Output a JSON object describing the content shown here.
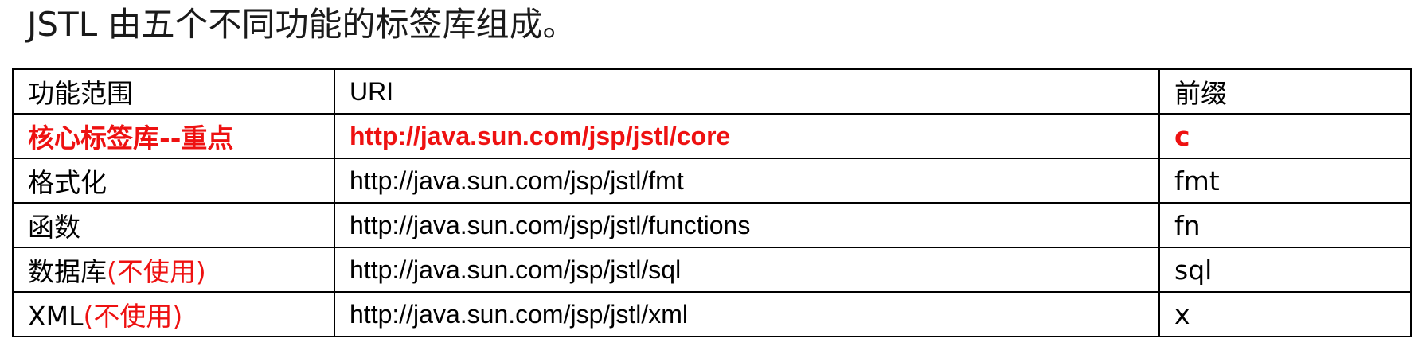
{
  "heading": "JSTL 由五个不同功能的标签库组成。",
  "table": {
    "headers": [
      "功能范围",
      "URI",
      "前缀"
    ],
    "rows": [
      {
        "scope": "核心标签库--重点",
        "note": "",
        "uri": "http://java.sun.com/jsp/jstl/core",
        "prefix": "c",
        "highlight": true
      },
      {
        "scope": "格式化",
        "note": "",
        "uri": "http://java.sun.com/jsp/jstl/fmt",
        "prefix": "fmt",
        "highlight": false
      },
      {
        "scope": "函数",
        "note": "",
        "uri": "http://java.sun.com/jsp/jstl/functions",
        "prefix": "fn",
        "highlight": false
      },
      {
        "scope": "数据库",
        "note": "(不使用)",
        "uri": "http://java.sun.com/jsp/jstl/sql",
        "prefix": "sql",
        "highlight": false
      },
      {
        "scope": "XML",
        "note": "(不使用)",
        "uri": "http://java.sun.com/jsp/jstl/xml",
        "prefix": "x",
        "highlight": false
      }
    ]
  },
  "colors": {
    "highlight": "#ee1111",
    "text": "#000000",
    "border": "#000000"
  }
}
